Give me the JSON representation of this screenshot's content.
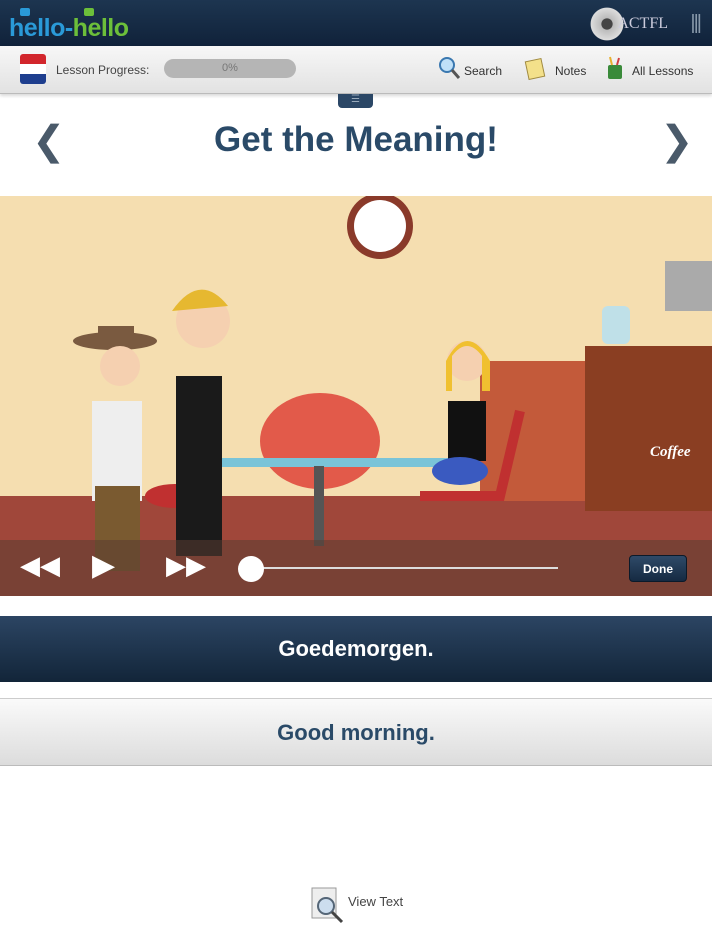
{
  "header": {
    "logo_part1": "hello",
    "logo_part2": "hello",
    "logo_sep": "-",
    "partner": "ACTFL"
  },
  "toolbar": {
    "progress_label": "Lesson Progress:",
    "progress_value": "0%",
    "progress_fraction": 0,
    "search": "Search",
    "notes": "Notes",
    "all_lessons": "All Lessons",
    "language_flag": "netherlands-flag-icon"
  },
  "main": {
    "title": "Get the Meaning!",
    "prev": "❮",
    "next": "❯"
  },
  "video": {
    "done": "Done",
    "position_fraction": 0,
    "sign_text": "Coffee"
  },
  "phrase": "Goedemorgen.",
  "translation": "Good morning.",
  "view_text": "View Text"
}
